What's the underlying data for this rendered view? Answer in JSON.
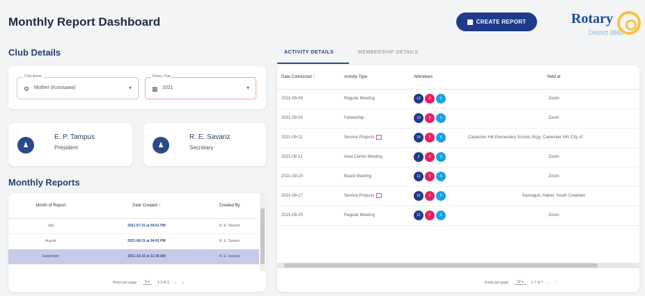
{
  "header": {
    "title": "Monthly Report Dashboard",
    "create_button": "CREATE REPORT"
  },
  "logo": {
    "word": "Rotary",
    "district": "District 3860"
  },
  "club_details": {
    "title": "Club Details",
    "club_field": {
      "label": "Club Name",
      "value": "Mother (Kurosawa)",
      "icon": "gear-icon"
    },
    "year_field": {
      "label": "Rotary Year",
      "value": "2021",
      "icon": "calendar-icon"
    }
  },
  "officers": [
    {
      "name": "E. P. Tampus",
      "role": "President",
      "icon": "person-icon"
    },
    {
      "name": "R. E. Savariz",
      "role": "Secretary",
      "icon": "person-add-icon"
    }
  ],
  "monthly_reports": {
    "title": "Monthly Reports",
    "columns": [
      "Month of Report",
      "Date Created ↑",
      "Created By"
    ],
    "rows": [
      {
        "month": "July",
        "date": "2021-07-31 at 04:01 PM",
        "by": "R. E. Savariz"
      },
      {
        "month": "August",
        "date": "2021-08-31 at 04:02 PM",
        "by": "R. E. Savariz"
      },
      {
        "month": "September",
        "date": "2021-10-10 at 11:38 AM",
        "by": "R. E. Savariz"
      }
    ],
    "pager": {
      "rows_label": "Rows per page:",
      "rows_value": "5",
      "range": "1-3 of 3"
    }
  },
  "tabs": [
    {
      "label": "ACTIVITY DETAILS"
    },
    {
      "label": "MEMBERSHIP DETAILS"
    }
  ],
  "activity": {
    "columns": [
      "Date Conducted ↑",
      "Activity Type",
      "Attendees",
      "Held at"
    ],
    "rows": [
      {
        "date": "2021-09-08",
        "type": "Regular Meeting",
        "a": "12",
        "b": "3",
        "c": "0",
        "held": "Zoom"
      },
      {
        "date": "2021-09-09",
        "type": "Fellowship",
        "a": "10",
        "b": "3",
        "c": "0",
        "held": "Zoom"
      },
      {
        "date": "2021-09-11",
        "type": "Service Projects",
        "a": "16",
        "b": "2",
        "c": "0",
        "held": "Carpenter Hill Elementary School, Brgy. Carpenter Hill, City of"
      },
      {
        "date": "2021-09-11",
        "type": "Area Comm Meeting",
        "a": "2",
        "b": "0",
        "c": "0",
        "held": "Zoom"
      },
      {
        "date": "2021-09-15",
        "type": "Board Meeting",
        "a": "11",
        "b": "0",
        "c": "0",
        "held": "Zoom"
      },
      {
        "date": "2021-09-17",
        "type": "Service Projects",
        "a": "15",
        "b": "0",
        "c": "0",
        "held": "Damaguit, Alabel, South Cotabato"
      },
      {
        "date": "2021-09-25",
        "type": "Regular Meeting",
        "a": "12",
        "b": "0",
        "c": "0",
        "held": "Zoom"
      }
    ],
    "pager": {
      "rows_label": "Rows per page:",
      "rows_value": "10",
      "range": "1-7 of 7"
    }
  },
  "colors": {
    "primary": "#1e3a8a",
    "pink": "#e81e63",
    "cyan": "#1ba0e6",
    "gold": "#f5c342"
  }
}
